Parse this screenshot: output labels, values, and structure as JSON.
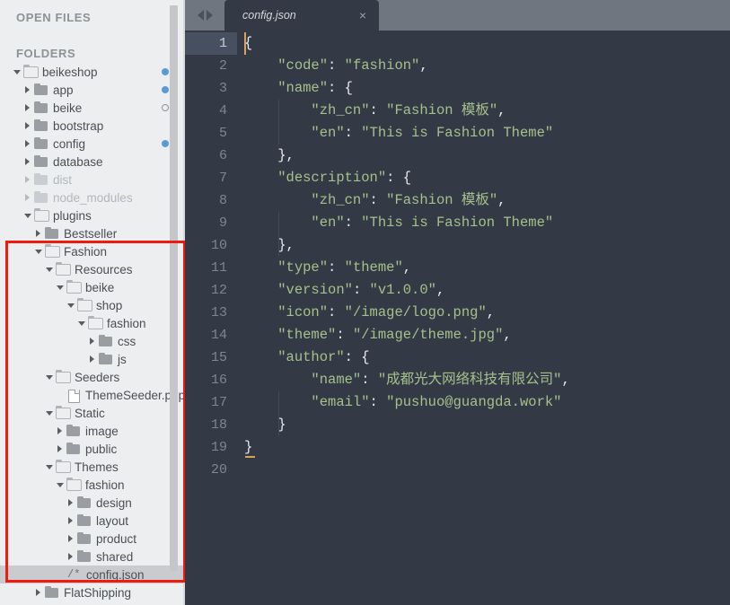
{
  "sidebar": {
    "open_files_label": "OPEN FILES",
    "folders_label": "FOLDERS",
    "tree": [
      {
        "label": "beikeshop",
        "depth": 0,
        "kind": "folder",
        "state": "open",
        "dot": "filled"
      },
      {
        "label": "app",
        "depth": 1,
        "kind": "folder",
        "state": "closed",
        "dot": "filled"
      },
      {
        "label": "beike",
        "depth": 1,
        "kind": "folder",
        "state": "closed",
        "dot": "hollow"
      },
      {
        "label": "bootstrap",
        "depth": 1,
        "kind": "folder",
        "state": "closed",
        "dot": "none"
      },
      {
        "label": "config",
        "depth": 1,
        "kind": "folder",
        "state": "closed",
        "dot": "filled"
      },
      {
        "label": "database",
        "depth": 1,
        "kind": "folder",
        "state": "closed",
        "dot": "none"
      },
      {
        "label": "dist",
        "depth": 1,
        "kind": "folder",
        "state": "closed",
        "dot": "none",
        "dim": true
      },
      {
        "label": "node_modules",
        "depth": 1,
        "kind": "folder",
        "state": "closed",
        "dot": "none",
        "dim": true
      },
      {
        "label": "plugins",
        "depth": 1,
        "kind": "folder",
        "state": "open",
        "dot": "none"
      },
      {
        "label": "Bestseller",
        "depth": 2,
        "kind": "folder",
        "state": "closed",
        "dot": "none"
      },
      {
        "label": "Fashion",
        "depth": 2,
        "kind": "folder",
        "state": "open",
        "dot": "none"
      },
      {
        "label": "Resources",
        "depth": 3,
        "kind": "folder",
        "state": "open",
        "dot": "none"
      },
      {
        "label": "beike",
        "depth": 4,
        "kind": "folder",
        "state": "open",
        "dot": "none"
      },
      {
        "label": "shop",
        "depth": 5,
        "kind": "folder",
        "state": "open",
        "dot": "none"
      },
      {
        "label": "fashion",
        "depth": 6,
        "kind": "folder",
        "state": "open",
        "dot": "none"
      },
      {
        "label": "css",
        "depth": 7,
        "kind": "folder",
        "state": "closed",
        "dot": "none"
      },
      {
        "label": "js",
        "depth": 7,
        "kind": "folder",
        "state": "closed",
        "dot": "none"
      },
      {
        "label": "Seeders",
        "depth": 3,
        "kind": "folder",
        "state": "open",
        "dot": "none"
      },
      {
        "label": "ThemeSeeder.php",
        "depth": 4,
        "kind": "file",
        "state": "none",
        "dot": "none"
      },
      {
        "label": "Static",
        "depth": 3,
        "kind": "folder",
        "state": "open",
        "dot": "none"
      },
      {
        "label": "image",
        "depth": 4,
        "kind": "folder",
        "state": "closed",
        "dot": "none"
      },
      {
        "label": "public",
        "depth": 4,
        "kind": "folder",
        "state": "closed",
        "dot": "none"
      },
      {
        "label": "Themes",
        "depth": 3,
        "kind": "folder",
        "state": "open",
        "dot": "none"
      },
      {
        "label": "fashion",
        "depth": 4,
        "kind": "folder",
        "state": "open",
        "dot": "none"
      },
      {
        "label": "design",
        "depth": 5,
        "kind": "folder",
        "state": "closed",
        "dot": "none"
      },
      {
        "label": "layout",
        "depth": 5,
        "kind": "folder",
        "state": "closed",
        "dot": "none"
      },
      {
        "label": "product",
        "depth": 5,
        "kind": "folder",
        "state": "closed",
        "dot": "none"
      },
      {
        "label": "shared",
        "depth": 5,
        "kind": "folder",
        "state": "closed",
        "dot": "none"
      },
      {
        "label": "config.json",
        "depth": 4,
        "kind": "json",
        "state": "none",
        "dot": "none",
        "selected": true,
        "icon_glyph": "/*"
      },
      {
        "label": "FlatShipping",
        "depth": 2,
        "kind": "folder",
        "state": "closed",
        "dot": "none"
      }
    ]
  },
  "editor": {
    "tab": {
      "title": "config.json",
      "close_glyph": "×"
    },
    "nav": {
      "back_label": "◀",
      "forward_label": "▶"
    },
    "line_numbers": [
      "1",
      "2",
      "3",
      "4",
      "5",
      "6",
      "7",
      "8",
      "9",
      "10",
      "11",
      "12",
      "13",
      "14",
      "15",
      "16",
      "17",
      "18",
      "19",
      "20"
    ],
    "active_line": 1,
    "lines": [
      "{",
      "    \"code\": \"fashion\",",
      "    \"name\": {",
      "        \"zh_cn\": \"Fashion 模板\",",
      "        \"en\": \"This is Fashion Theme\"",
      "    },",
      "    \"description\": {",
      "        \"zh_cn\": \"Fashion 模板\",",
      "        \"en\": \"This is Fashion Theme\"",
      "    },",
      "    \"type\": \"theme\",",
      "    \"version\": \"v1.0.0\",",
      "    \"icon\": \"/image/logo.png\",",
      "    \"theme\": \"/image/theme.jpg\",",
      "    \"author\": {",
      "        \"name\": \"成都光大网络科技有限公司\",",
      "        \"email\": \"pushuo@guangda.work\"",
      "    }",
      "}",
      ""
    ]
  },
  "annotation": {
    "highlight_color": "#ee1b11"
  },
  "colors": {
    "sidebar_bg": "#eceef0",
    "editor_bg": "#333a45",
    "tabbar_bg": "#70767f",
    "string_green": "#a6c08c",
    "dot_blue": "#5b9bd5",
    "selection_gray": "#c9cbce"
  }
}
